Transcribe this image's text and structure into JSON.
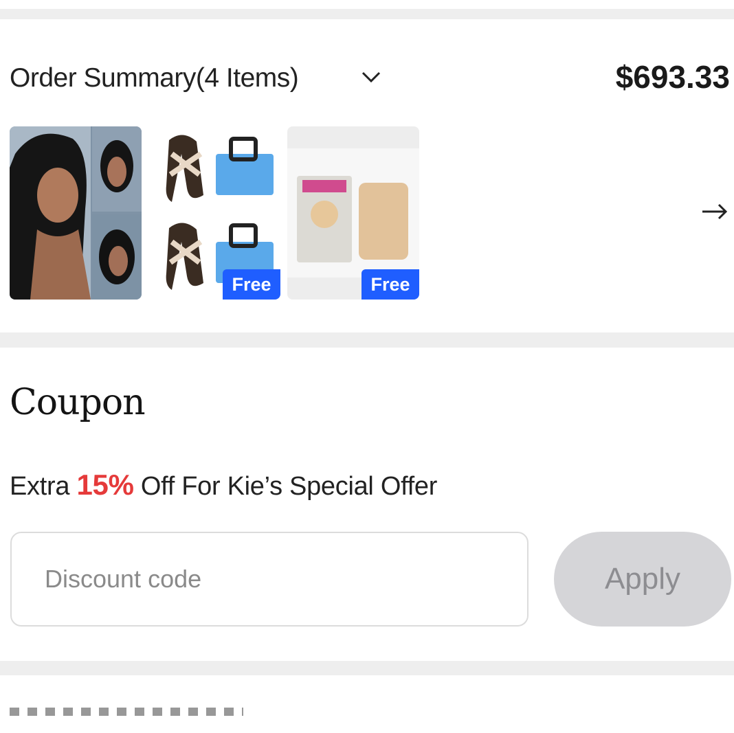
{
  "order_summary": {
    "title": "Order Summary(4 Items)",
    "total": "$693.33",
    "items": [
      {
        "icon": "wig-product-image",
        "badge": ""
      },
      {
        "icon": "scarf-and-bag-product-image",
        "badge": "Free"
      },
      {
        "icon": "wig-cap-product-image",
        "badge": "Free"
      }
    ]
  },
  "coupon": {
    "title": "Coupon",
    "offer_prefix": "Extra",
    "offer_percent": "15%",
    "offer_suffix": "Off For Kie’s Special Offer",
    "input_placeholder": "Discount code",
    "apply_label": "Apply"
  },
  "colors": {
    "accent_blue": "#1f5eff",
    "offer_red": "#e53a3a",
    "apply_disabled_bg": "#d5d5d8"
  }
}
